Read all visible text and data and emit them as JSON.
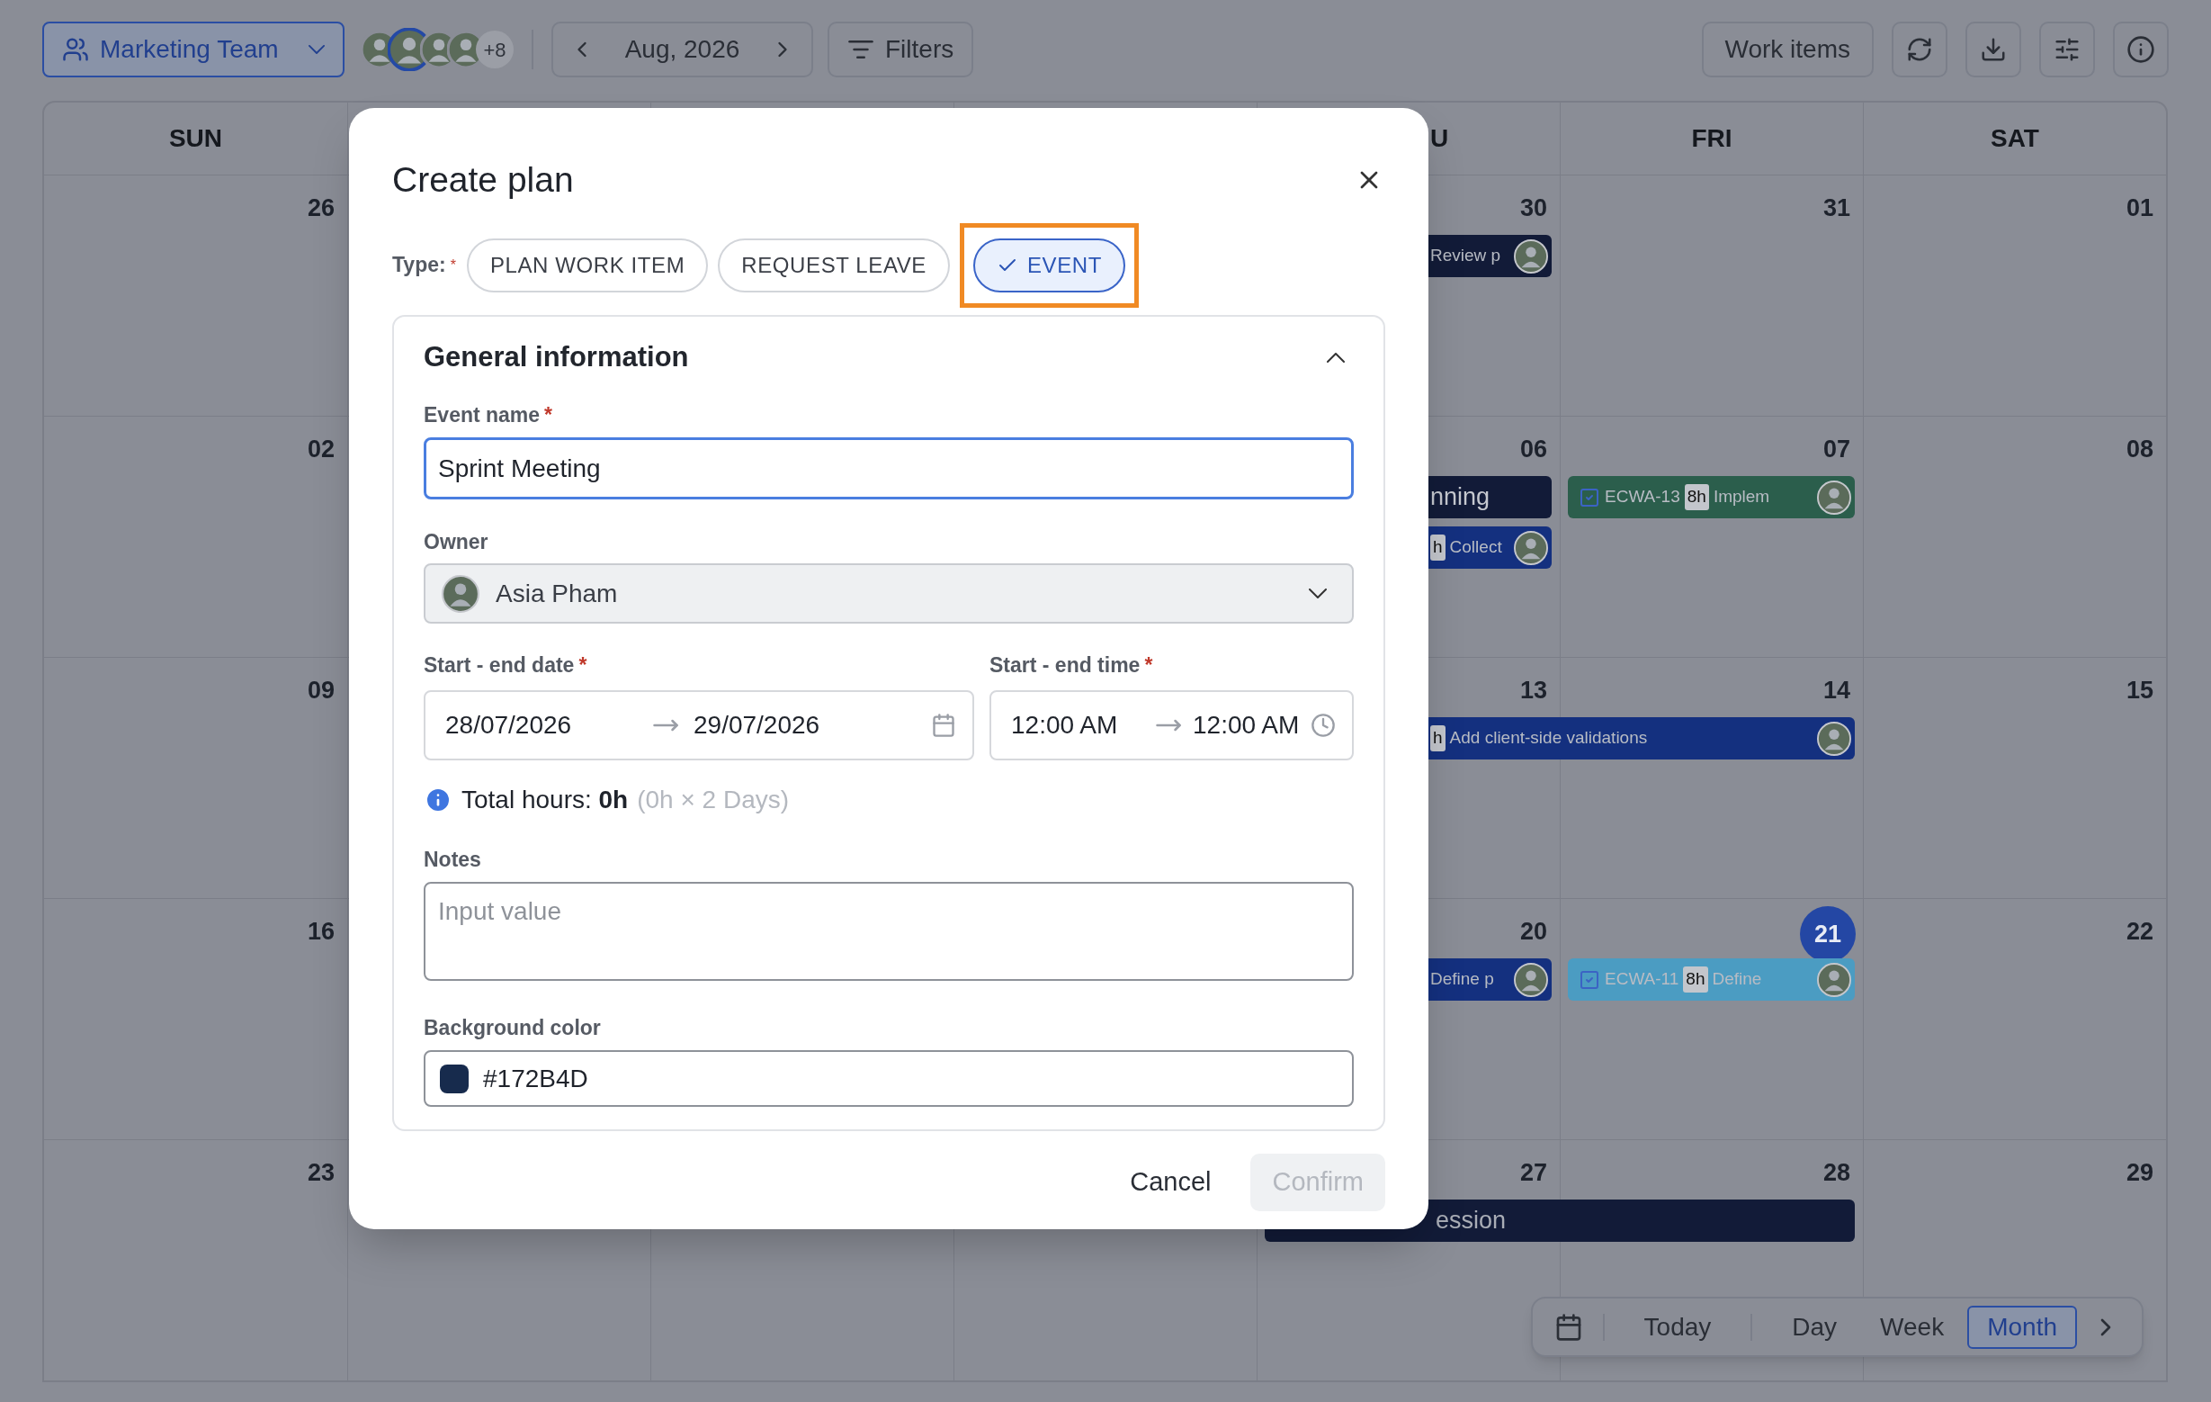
{
  "toolbar": {
    "team": {
      "label": "Marketing Team"
    },
    "avatars": [
      {
        "selected": false
      },
      {
        "selected": true
      },
      {
        "selected": false
      },
      {
        "selected": false
      }
    ],
    "more_members": "+8",
    "period": "Aug, 2026",
    "filters": "Filters",
    "work_items": "Work items"
  },
  "calendar": {
    "headers": {
      "sun": "SUN",
      "thu": "U",
      "fri": "FRI",
      "sat": "SAT"
    },
    "weeks": [
      {
        "sun": {
          "date": "26",
          "today": false
        },
        "thu": {
          "date": "30",
          "today": false,
          "events": [
            {
              "kind": "task",
              "checkbox": false,
              "title": "Review p",
              "color": "#121b38",
              "avatar": true,
              "clipped": true,
              "continues": false
            }
          ]
        },
        "fri": {
          "date": "31",
          "today": false
        },
        "sat": {
          "date": "01",
          "today": false
        }
      },
      {
        "sun": {
          "date": "02",
          "today": false
        },
        "thu": {
          "date": "06",
          "today": false,
          "events": [
            {
              "kind": "event",
              "title": "nning",
              "color": "#121b38",
              "clipped": true,
              "continues": false
            },
            {
              "kind": "task",
              "checkbox": false,
              "hours": "h",
              "title": "Collect",
              "color": "#14307f",
              "avatar": true,
              "clipped": true,
              "continues": false
            }
          ]
        },
        "fri": {
          "date": "07",
          "today": false,
          "events": [
            {
              "kind": "task",
              "checkbox": true,
              "id": "ECWA-13",
              "hours": "8h",
              "title": "Implem",
              "color": "#2b5e4c",
              "avatar": true,
              "clipped": false,
              "continues": false
            }
          ]
        },
        "sat": {
          "date": "08",
          "today": false
        }
      },
      {
        "sun": {
          "date": "09",
          "today": false
        },
        "thu": {
          "date": "13",
          "today": false,
          "events": [
            {
              "kind": "task",
              "checkbox": false,
              "hours": "h",
              "title": "Add client-side validations",
              "color": "#14307f",
              "avatar": true,
              "clipped": true,
              "continues": true
            }
          ]
        },
        "fri": {
          "date": "14",
          "today": false
        },
        "sat": {
          "date": "15",
          "today": false
        }
      },
      {
        "sun": {
          "date": "16",
          "today": false
        },
        "thu": {
          "date": "20",
          "today": false,
          "events": [
            {
              "kind": "task",
              "checkbox": false,
              "title": "Define p",
              "color": "#14307f",
              "avatar": true,
              "clipped": true,
              "continues": false
            }
          ]
        },
        "fri": {
          "date": "21",
          "today": true,
          "events": [
            {
              "kind": "task",
              "checkbox": true,
              "id": "ECWA-11",
              "hours": "8h",
              "title": "Define",
              "color": "#4b9cc2",
              "avatar": true,
              "clipped": false,
              "continues": false
            }
          ]
        },
        "sat": {
          "date": "22",
          "today": false
        }
      },
      {
        "sun": {
          "date": "23",
          "today": false
        },
        "thu": {
          "date": "27",
          "today": false,
          "events": [
            {
              "kind": "event",
              "title": "ession",
              "color": "#121b38",
              "clipped": true,
              "continues": true
            }
          ]
        },
        "fri": {
          "date": "28",
          "today": false
        },
        "sat": {
          "date": "29",
          "today": false
        }
      }
    ]
  },
  "view_switcher": {
    "items": [
      {
        "label": "Today",
        "kind": "action",
        "selected": false
      },
      {
        "label": "Day",
        "kind": "view",
        "selected": false
      },
      {
        "label": "Week",
        "kind": "view",
        "selected": false
      },
      {
        "label": "Month",
        "kind": "view",
        "selected": true
      }
    ]
  },
  "modal": {
    "title": "Create plan",
    "required_mark": "*",
    "type_label": "Type:",
    "types": [
      {
        "label": "PLAN WORK ITEM",
        "selected": false,
        "highlighted": false
      },
      {
        "label": "REQUEST LEAVE",
        "selected": false,
        "highlighted": false
      },
      {
        "label": "EVENT",
        "selected": true,
        "highlighted": true
      }
    ],
    "section": {
      "title": "General information",
      "expanded": true,
      "event_name": {
        "label": "Event name",
        "required": true,
        "value": "Sprint Meeting",
        "focused": true
      },
      "owner": {
        "label": "Owner",
        "required": false,
        "value": "Asia Pham"
      },
      "date_range": {
        "label": "Start - end date",
        "required": true,
        "start": "28/07/2026",
        "end": "29/07/2026"
      },
      "time_range": {
        "label": "Start - end time",
        "required": true,
        "start": "12:00 AM",
        "end": "12:00 AM"
      },
      "total_hours": {
        "text": "Total hours: **0h**",
        "detail": "(0h × 2 Days)"
      },
      "notes": {
        "label": "Notes",
        "required": false,
        "placeholder": "Input value"
      },
      "background_color": {
        "label": "Background color",
        "required": false,
        "value": "#172B4D",
        "color": "#172b4d"
      }
    },
    "buttons": [
      {
        "label": "Cancel",
        "kind": "text",
        "disabled": false
      },
      {
        "label": "Confirm",
        "kind": "primary",
        "disabled": true
      }
    ]
  }
}
